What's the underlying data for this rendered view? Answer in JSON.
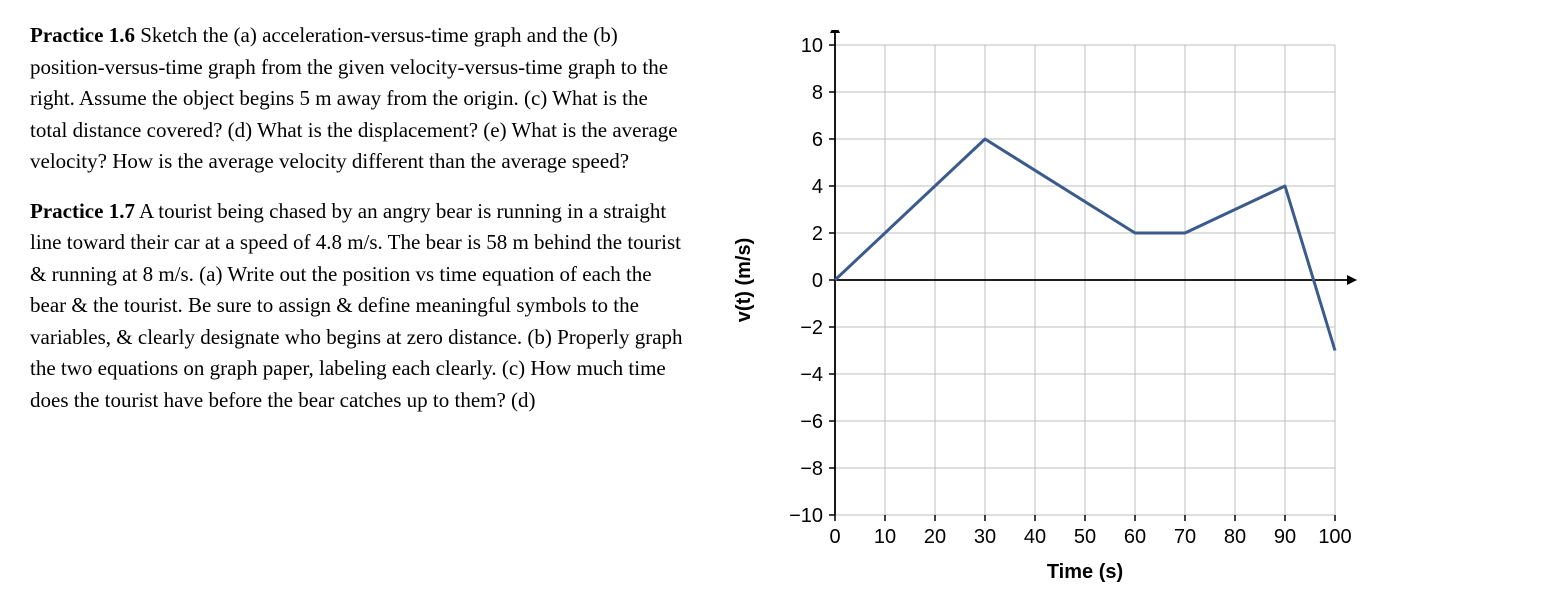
{
  "practice16": {
    "lead": "Practice 1.6",
    "body": "  Sketch the (a) acceleration-versus-time graph and the (b) position-versus-time graph from the given velocity-versus-time graph to the right. Assume the object begins 5 m away from the origin. (c) What is the total distance covered? (d) What is the displacement? (e) What is the average velocity? How is the average velocity different than the average speed?"
  },
  "practice17": {
    "lead": "Practice 1.7",
    "body": "  A tourist being chased by an angry bear is running in a straight line toward their car at a speed of 4.8 m/s. The bear is 58 m behind the tourist & running at 8 m/s. (a) Write out the position vs time equation of each the bear & the tourist. Be sure to assign & define meaningful symbols to the variables, & clearly designate who begins at zero distance. (b) Properly graph the two equations on graph paper, labeling each clearly. (c) How much time does the tourist have before the bear catches up to them? (d)"
  },
  "chart_data": {
    "type": "line",
    "title": "",
    "xlabel": "Time (s)",
    "ylabel": "v(t) (m/s)",
    "xlim": [
      0,
      100
    ],
    "ylim": [
      -10,
      10
    ],
    "xticks": [
      0,
      10,
      20,
      30,
      40,
      50,
      60,
      70,
      80,
      90,
      100
    ],
    "yticks": [
      -10,
      -8,
      -6,
      -4,
      -2,
      0,
      2,
      4,
      6,
      8,
      10
    ],
    "series": [
      {
        "name": "velocity",
        "x": [
          0,
          30,
          60,
          70,
          90,
          100
        ],
        "y": [
          0,
          6,
          2,
          2,
          4,
          -3
        ]
      }
    ],
    "grid": true
  }
}
